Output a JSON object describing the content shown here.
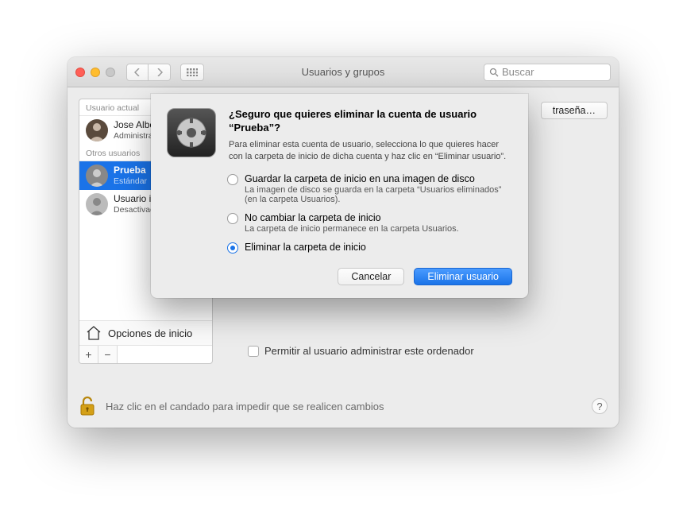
{
  "window": {
    "title": "Usuarios y grupos",
    "search_placeholder": "Buscar"
  },
  "sidebar": {
    "current_header": "Usuario actual",
    "others_header": "Otros usuarios",
    "current": {
      "name": "Jose Albe",
      "role": "Administra"
    },
    "others": [
      {
        "name": "Prueba",
        "role": "Estándar",
        "selected": true
      },
      {
        "name": "Usuario i",
        "role": "Desactivad",
        "selected": false
      }
    ],
    "startup_opts": "Opciones de inicio"
  },
  "main": {
    "change_pw": "traseña…",
    "admin_check": "Permitir al usuario administrar este ordenador"
  },
  "lock": {
    "text": "Haz clic en el candado para impedir que se realicen cambios",
    "help": "?"
  },
  "sheet": {
    "title": "¿Seguro que quieres eliminar la cuenta de usuario “Prueba”?",
    "desc": "Para eliminar esta cuenta de usuario, selecciona lo que quieres hacer con la carpeta de inicio de dicha cuenta y haz clic en “Eliminar usuario”.",
    "options": [
      {
        "label": "Guardar la carpeta de inicio en una imagen de disco",
        "sub": "La imagen de disco se guarda en la carpeta “Usuarios eliminados” (en la carpeta Usuarios).",
        "selected": false
      },
      {
        "label": "No cambiar la carpeta de inicio",
        "sub": "La carpeta de inicio permanece en la carpeta Usuarios.",
        "selected": false
      },
      {
        "label": "Eliminar la carpeta de inicio",
        "sub": "",
        "selected": true
      }
    ],
    "cancel": "Cancelar",
    "confirm": "Eliminar usuario"
  }
}
